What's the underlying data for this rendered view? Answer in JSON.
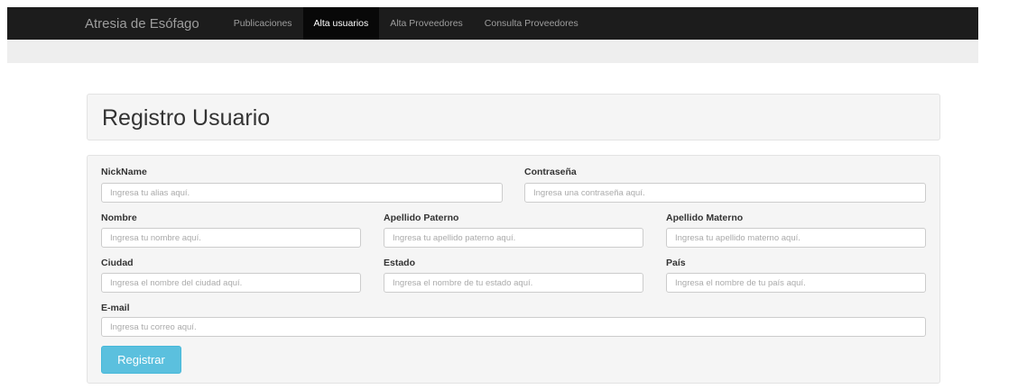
{
  "navbar": {
    "brand": "Atresia de Esófago",
    "items": [
      {
        "label": "Publicaciones"
      },
      {
        "label": "Alta usuarios"
      },
      {
        "label": "Alta Proveedores"
      },
      {
        "label": "Consulta Proveedores"
      }
    ],
    "active": "Alta usuarios"
  },
  "page": {
    "title": "Registro Usuario"
  },
  "form": {
    "nickname": {
      "label": "NickName",
      "placeholder": "Ingresa tu alias aquí."
    },
    "password": {
      "label": "Contraseña",
      "placeholder": "Ingresa una contraseña aquí."
    },
    "nombre": {
      "label": "Nombre",
      "placeholder": "Ingresa tu nombre aquí."
    },
    "apellido_paterno": {
      "label": "Apellido Paterno",
      "placeholder": "Ingresa tu apellido paterno aquí."
    },
    "apellido_materno": {
      "label": "Apellido Materno",
      "placeholder": "Ingresa tu apellido materno aquí."
    },
    "ciudad": {
      "label": "Ciudad",
      "placeholder": "Ingresa el nombre del ciudad aquí."
    },
    "estado": {
      "label": "Estado",
      "placeholder": "Ingresa el nombre de tu estado aquí."
    },
    "pais": {
      "label": "País",
      "placeholder": "Ingresa el nombre de tu país aquí."
    },
    "email": {
      "label": "E-mail",
      "placeholder": "Ingresa tu correo aquí."
    },
    "submit_label": "Registrar"
  },
  "colors": {
    "navbar_bg": "#1c1c1c",
    "button_bg": "#5bc0de"
  }
}
